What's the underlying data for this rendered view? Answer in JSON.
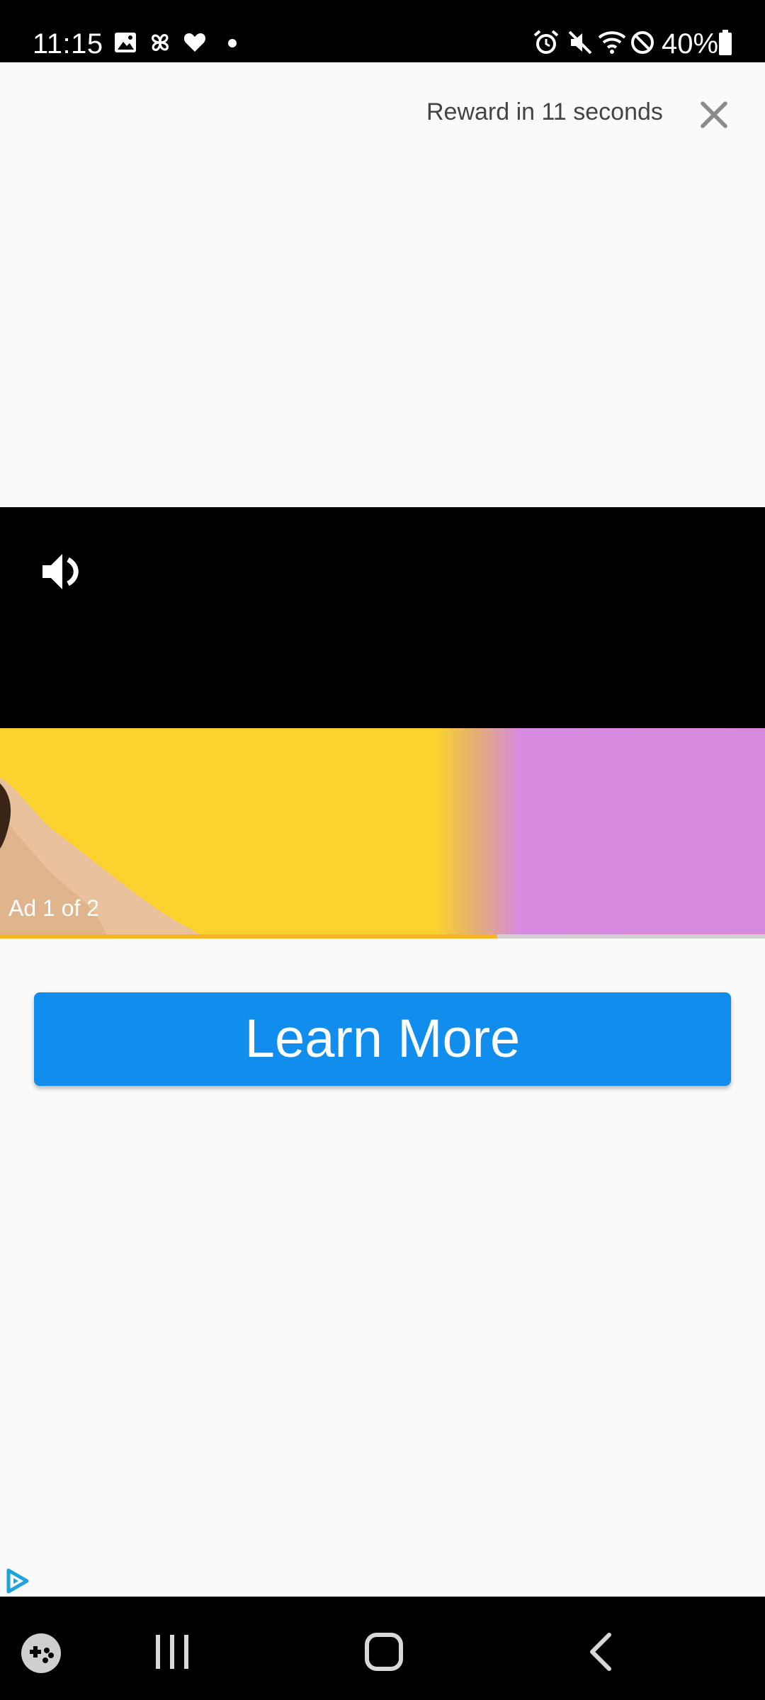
{
  "status_bar": {
    "time": "11:15",
    "battery": "40%",
    "icons": [
      "gallery-icon",
      "pinwheel-icon",
      "heart-icon",
      "dot-icon",
      "alarm-icon",
      "mute-icon",
      "wifi-icon",
      "block-icon",
      "battery-icon"
    ]
  },
  "reward": {
    "countdown_text": "Reward in 11 seconds",
    "close_icon": "close-icon"
  },
  "video": {
    "volume_icon": "volume-icon",
    "ad_counter": "Ad 1 of 2",
    "progress_fraction": 0.65,
    "colors": {
      "yellow": "#fcd22f",
      "purple": "#d78add",
      "progress": "#f7b52a"
    }
  },
  "cta": {
    "label": "Learn More",
    "color": "#118ded"
  },
  "adchoices_icon": "adchoices-icon",
  "nav_bar": {
    "icons": [
      "game-launcher-icon",
      "recents-icon",
      "home-icon",
      "back-icon"
    ]
  }
}
